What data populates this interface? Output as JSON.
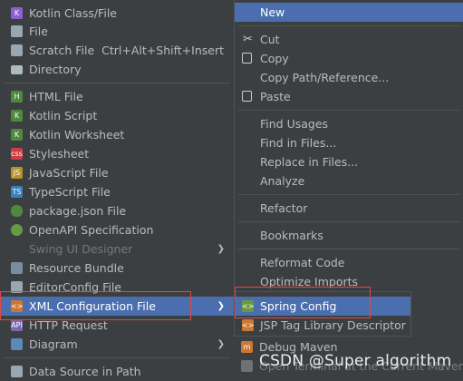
{
  "left_menu": {
    "items": [
      {
        "label": "Kotlin Class/File",
        "icon": "kotlin-icon",
        "color": "#8e5fd1"
      },
      {
        "label": "File",
        "icon": "file-icon",
        "color": "#9aa7b0"
      },
      {
        "label": "Scratch File",
        "shortcut": "Ctrl+Alt+Shift+Insert",
        "icon": "scratch-file-icon",
        "color": "#9aa7b0"
      },
      {
        "label": "Directory",
        "icon": "folder-icon",
        "color": "#aeb9c0"
      },
      {
        "label": "HTML File",
        "icon": "html-file-icon",
        "color": "#4e8a3c"
      },
      {
        "label": "Kotlin Script",
        "icon": "kotlin-script-icon",
        "color": "#4e8a3c"
      },
      {
        "label": "Kotlin Worksheet",
        "icon": "kotlin-worksheet-icon",
        "color": "#4e8a3c"
      },
      {
        "label": "Stylesheet",
        "icon": "css-file-icon",
        "color": "#cc3e44"
      },
      {
        "label": "JavaScript File",
        "icon": "js-file-icon",
        "color": "#b8932a"
      },
      {
        "label": "TypeScript File",
        "icon": "ts-file-icon",
        "color": "#3c7fb8"
      },
      {
        "label": "package.json File",
        "icon": "nodejs-icon",
        "color": "#4e8a3c"
      },
      {
        "label": "OpenAPI Specification",
        "icon": "openapi-icon",
        "color": "#6a9a40"
      },
      {
        "label": "Swing UI Designer",
        "icon": "none",
        "disabled": true
      },
      {
        "label": "Resource Bundle",
        "icon": "resource-bundle-icon",
        "color": "#7a8da0"
      },
      {
        "label": "EditorConfig File",
        "icon": "editorconfig-icon",
        "color": "#9aa7b0"
      },
      {
        "label": "XML Configuration File",
        "icon": "xml-file-icon",
        "color": "#cc7832",
        "selected": true
      },
      {
        "label": "HTTP Request",
        "icon": "http-request-icon",
        "color": "#7a6ab0"
      },
      {
        "label": "Diagram",
        "icon": "diagram-icon",
        "color": "#5c8ab8"
      },
      {
        "label": "Data Source in Path",
        "icon": "data-source-icon",
        "color": "#9aa7b0"
      }
    ]
  },
  "right_menu": {
    "items": [
      {
        "label": "New",
        "selected": true
      },
      {
        "label": "Cut",
        "icon": "scissors-icon"
      },
      {
        "label": "Copy",
        "icon": "copy-icon"
      },
      {
        "label": "Copy Path/Reference..."
      },
      {
        "label": "Paste",
        "icon": "paste-icon"
      },
      {
        "label": "Find Usages"
      },
      {
        "label": "Find in Files..."
      },
      {
        "label": "Replace in Files..."
      },
      {
        "label": "Analyze"
      },
      {
        "label": "Refactor"
      },
      {
        "label": "Bookmarks"
      },
      {
        "label": "Reformat Code"
      },
      {
        "label": "Optimize Imports"
      },
      {
        "label": "Spring Config",
        "icon": "spring-icon",
        "selected": true
      },
      {
        "label": "JSP Tag Library Descriptor",
        "icon": "jsp-icon"
      },
      {
        "label": "Debug Maven",
        "icon": "maven-icon"
      },
      {
        "label": "Open Terminal at the Current Maven M",
        "icon": "terminal-icon"
      }
    ]
  },
  "watermark": "CSDN @Super algorithm",
  "colors": {
    "selection": "#4b6eaf",
    "highlight_box": "#e04848",
    "background": "#3c3f41"
  }
}
